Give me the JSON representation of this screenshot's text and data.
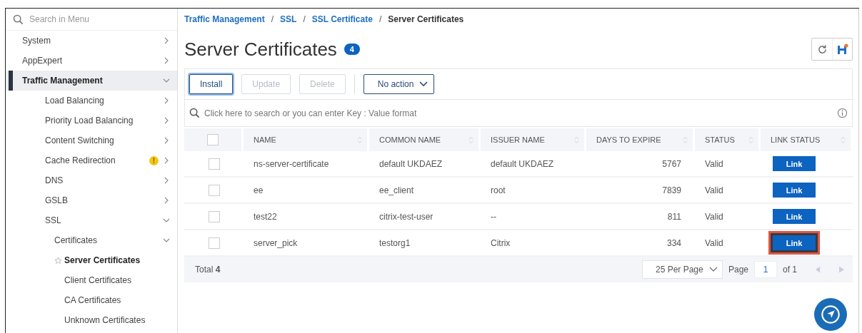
{
  "sidebar": {
    "search": {
      "placeholder": "Search in Menu"
    },
    "items": [
      {
        "label": "System",
        "selected": false,
        "expanded": false
      },
      {
        "label": "AppExpert",
        "selected": false,
        "expanded": false
      },
      {
        "label": "Traffic Management",
        "selected": true,
        "expanded": true,
        "children": [
          {
            "label": "Load Balancing",
            "selected": false,
            "expanded": false
          },
          {
            "label": "Priority Load Balancing",
            "selected": false,
            "expanded": false
          },
          {
            "label": "Content Switching",
            "selected": false,
            "expanded": false
          },
          {
            "label": "Cache Redirection",
            "selected": false,
            "expanded": false,
            "warning_badge": "!"
          },
          {
            "label": "DNS",
            "selected": false,
            "expanded": false
          },
          {
            "label": "GSLB",
            "selected": false,
            "expanded": false
          },
          {
            "label": "SSL",
            "selected": false,
            "expanded": true,
            "children": [
              {
                "label": "Certificates",
                "selected": false,
                "expanded": true,
                "children": [
                  {
                    "label": "Server Certificates",
                    "selected": true
                  },
                  {
                    "label": "Client Certificates",
                    "selected": false
                  },
                  {
                    "label": "CA Certificates",
                    "selected": false
                  },
                  {
                    "label": "Unknown Certificates",
                    "selected": false
                  }
                ]
              }
            ]
          }
        ]
      }
    ]
  },
  "breadcrumb": [
    {
      "label": "Traffic Management",
      "link": true
    },
    {
      "label": "SSL",
      "link": true
    },
    {
      "label": "SSL Certificate",
      "link": true
    },
    {
      "label": "Server Certificates",
      "link": false
    }
  ],
  "breadcrumb_separator": "/",
  "page": {
    "title": "Server Certificates",
    "count": "4"
  },
  "toolbar": {
    "buttons": [
      {
        "label": "Install",
        "disabled": false,
        "focused": true
      },
      {
        "label": "Update",
        "disabled": true,
        "focused": false
      },
      {
        "label": "Delete",
        "disabled": true,
        "focused": false
      }
    ],
    "action_dropdown": "No action"
  },
  "search": {
    "placeholder": "Click here to search or you can enter Key : Value format"
  },
  "table": {
    "select_all_checked": false,
    "columns": [
      "NAME",
      "COMMON NAME",
      "ISSUER NAME",
      "DAYS TO EXPIRE",
      "STATUS",
      "LINK STATUS"
    ],
    "rows": [
      {
        "checked": false,
        "name": "ns-server-certificate",
        "common_name": "default UKDAEZ",
        "issuer_name": "default UKDAEZ",
        "days_to_expire": "5767",
        "status": "Valid",
        "link": "Link",
        "highlighted": false
      },
      {
        "checked": false,
        "name": "ee",
        "common_name": "ee_client",
        "issuer_name": "root",
        "days_to_expire": "7839",
        "status": "Valid",
        "link": "Link",
        "highlighted": false
      },
      {
        "checked": false,
        "name": "test22",
        "common_name": "citrix-test-user",
        "issuer_name": "--",
        "days_to_expire": "811",
        "status": "Valid",
        "link": "Link",
        "highlighted": false
      },
      {
        "checked": false,
        "name": "server_pick",
        "common_name": "testorg1",
        "issuer_name": "Citrix",
        "days_to_expire": "334",
        "status": "Valid",
        "link": "Link",
        "highlighted": true
      }
    ],
    "footer": {
      "total_label": "Total",
      "total": "4",
      "per_page": "25 Per Page",
      "page_label": "Page",
      "page": "1",
      "of_label": "of 1"
    }
  }
}
